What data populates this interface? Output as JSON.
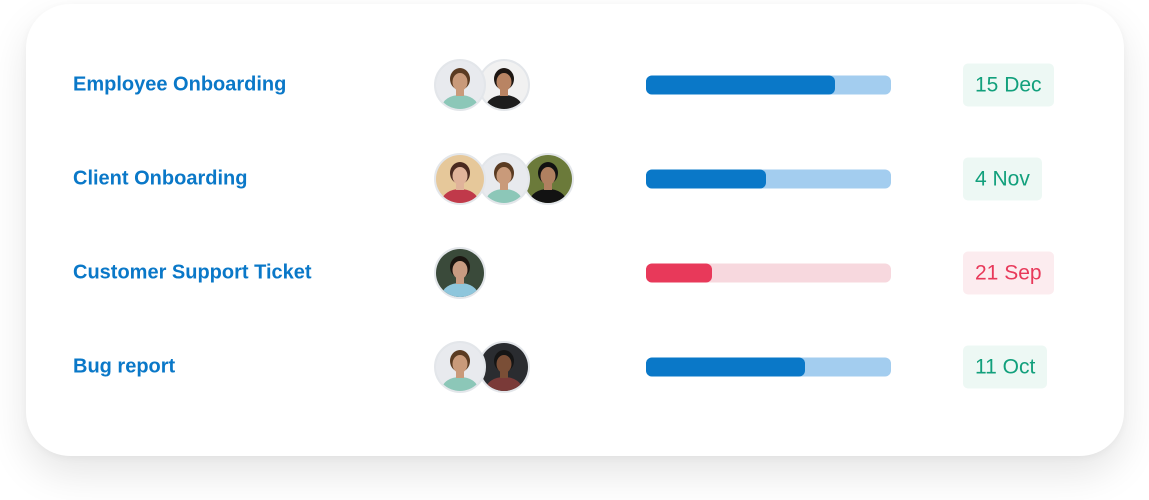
{
  "colors": {
    "title": "#0a78c8",
    "blue_fill": "#0a78c8",
    "blue_track": "#a3cdef",
    "red_fill": "#e8395a",
    "red_track": "#f7d8de",
    "green_text": "#12a07c",
    "green_bg": "#edf8f4",
    "red_text": "#e8395a",
    "red_bg": "#fcecef"
  },
  "tasks": [
    {
      "title": "Employee Onboarding",
      "assignees": [
        {
          "name": "curly-haired-man-avatar",
          "bg": "#e8eaee",
          "skin": "#c99a7a",
          "hair": "#5a3b22",
          "shirt": "#8cc7b8"
        },
        {
          "name": "woman-with-child-avatar",
          "bg": "#f1f1f1",
          "skin": "#b98463",
          "hair": "#1d1612",
          "shirt": "#1d1d1d"
        }
      ],
      "progress": 0.77,
      "status": "ok",
      "due": "15 Dec"
    },
    {
      "title": "Client Onboarding",
      "assignees": [
        {
          "name": "woman-avatar",
          "bg": "#e6c89a",
          "skin": "#e0b39a",
          "hair": "#4a2a20",
          "shirt": "#c0394a"
        },
        {
          "name": "curly-haired-man-avatar",
          "bg": "#e8eaee",
          "skin": "#c99a7a",
          "hair": "#5a3b22",
          "shirt": "#8cc7b8"
        },
        {
          "name": "woman-in-hijab-avatar",
          "bg": "#6b7a3a",
          "skin": "#b08060",
          "hair": "#121212",
          "shirt": "#121212"
        }
      ],
      "progress": 0.49,
      "status": "ok",
      "due": "4 Nov"
    },
    {
      "title": "Customer Support Ticket",
      "assignees": [
        {
          "name": "young-man-avatar",
          "bg": "#3a4a3a",
          "skin": "#c89b82",
          "hair": "#1a1410",
          "shirt": "#8ec6dc"
        }
      ],
      "progress": 0.27,
      "status": "overdue",
      "due": "21 Sep"
    },
    {
      "title": "Bug report",
      "assignees": [
        {
          "name": "curly-haired-man-avatar",
          "bg": "#e8eaee",
          "skin": "#c99a7a",
          "hair": "#5a3b22",
          "shirt": "#8cc7b8"
        },
        {
          "name": "bearded-man-avatar",
          "bg": "#2a2c30",
          "skin": "#7a4e36",
          "hair": "#151515",
          "shirt": "#7a3a38"
        }
      ],
      "progress": 0.65,
      "status": "ok",
      "due": "11 Oct"
    }
  ]
}
